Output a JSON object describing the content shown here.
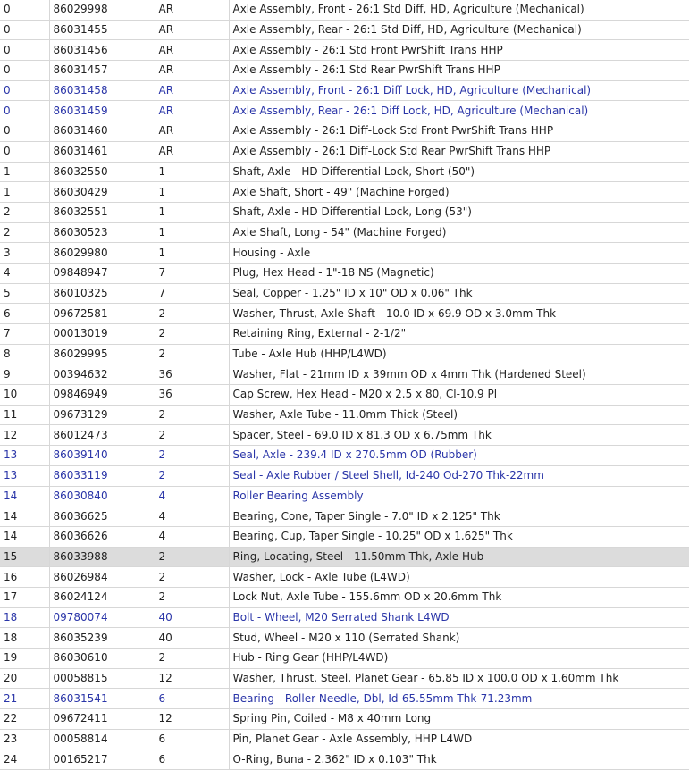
{
  "parts_table": {
    "rows": [
      {
        "ref": "0",
        "part": "86029998",
        "qty": "AR",
        "desc": "Axle Assembly, Front - 26:1 Std Diff, HD, Agriculture (Mechanical)",
        "link": false
      },
      {
        "ref": "0",
        "part": "86031455",
        "qty": "AR",
        "desc": "Axle Assembly, Rear - 26:1 Std Diff, HD, Agriculture (Mechanical)",
        "link": false
      },
      {
        "ref": "0",
        "part": "86031456",
        "qty": "AR",
        "desc": "Axle Assembly - 26:1 Std Front PwrShift Trans HHP",
        "link": false
      },
      {
        "ref": "0",
        "part": "86031457",
        "qty": "AR",
        "desc": "Axle Assembly - 26:1 Std Rear PwrShift Trans HHP",
        "link": false
      },
      {
        "ref": "0",
        "part": "86031458",
        "qty": "AR",
        "desc": "Axle Assembly, Front - 26:1 Diff Lock, HD, Agriculture (Mechanical)",
        "link": true
      },
      {
        "ref": "0",
        "part": "86031459",
        "qty": "AR",
        "desc": "Axle Assembly, Rear - 26:1 Diff Lock, HD, Agriculture (Mechanical)",
        "link": true
      },
      {
        "ref": "0",
        "part": "86031460",
        "qty": "AR",
        "desc": "Axle Assembly - 26:1 Diff-Lock Std Front PwrShift Trans HHP",
        "link": false
      },
      {
        "ref": "0",
        "part": "86031461",
        "qty": "AR",
        "desc": "Axle Assembly - 26:1 Diff-Lock Std Rear PwrShift Trans HHP",
        "link": false
      },
      {
        "ref": "1",
        "part": "86032550",
        "qty": "1",
        "desc": "Shaft, Axle - HD Differential Lock, Short (50\")",
        "link": false
      },
      {
        "ref": "1",
        "part": "86030429",
        "qty": "1",
        "desc": "Axle Shaft, Short - 49\" (Machine Forged)",
        "link": false
      },
      {
        "ref": "2",
        "part": "86032551",
        "qty": "1",
        "desc": "Shaft, Axle - HD Differential Lock, Long (53\")",
        "link": false
      },
      {
        "ref": "2",
        "part": "86030523",
        "qty": "1",
        "desc": "Axle Shaft, Long - 54\" (Machine Forged)",
        "link": false
      },
      {
        "ref": "3",
        "part": "86029980",
        "qty": "1",
        "desc": "Housing - Axle",
        "link": false
      },
      {
        "ref": "4",
        "part": "09848947",
        "qty": "7",
        "desc": "Plug, Hex Head - 1\"-18 NS (Magnetic)",
        "link": false
      },
      {
        "ref": "5",
        "part": "86010325",
        "qty": "7",
        "desc": "Seal, Copper - 1.25\" ID x 10\" OD x 0.06\" Thk",
        "link": false
      },
      {
        "ref": "6",
        "part": "09672581",
        "qty": "2",
        "desc": "Washer, Thrust, Axle Shaft - 10.0 ID x 69.9 OD x 3.0mm Thk",
        "link": false
      },
      {
        "ref": "7",
        "part": "00013019",
        "qty": "2",
        "desc": "Retaining Ring, External - 2-1/2\"",
        "link": false
      },
      {
        "ref": "8",
        "part": "86029995",
        "qty": "2",
        "desc": "Tube - Axle Hub (HHP/L4WD)",
        "link": false
      },
      {
        "ref": "9",
        "part": "00394632",
        "qty": "36",
        "desc": "Washer, Flat - 21mm ID x 39mm OD x 4mm Thk (Hardened Steel)",
        "link": false
      },
      {
        "ref": "10",
        "part": "09846949",
        "qty": "36",
        "desc": "Cap Screw, Hex Head - M20 x 2.5 x 80, Cl-10.9 Pl",
        "link": false
      },
      {
        "ref": "11",
        "part": "09673129",
        "qty": "2",
        "desc": "Washer, Axle Tube - 11.0mm Thick (Steel)",
        "link": false
      },
      {
        "ref": "12",
        "part": "86012473",
        "qty": "2",
        "desc": "Spacer, Steel - 69.0 ID x 81.3 OD x 6.75mm Thk",
        "link": false
      },
      {
        "ref": "13",
        "part": "86039140",
        "qty": "2",
        "desc": "Seal, Axle - 239.4 ID x 270.5mm OD (Rubber)",
        "link": true
      },
      {
        "ref": "13",
        "part": "86033119",
        "qty": "2",
        "desc": "Seal - Axle Rubber / Steel Shell, Id-240 Od-270 Thk-22mm",
        "link": true
      },
      {
        "ref": "14",
        "part": "86030840",
        "qty": "4",
        "desc": "Roller Bearing Assembly",
        "link": true
      },
      {
        "ref": "14",
        "part": "86036625",
        "qty": "4",
        "desc": "Bearing, Cone, Taper Single - 7.0\" ID x 2.125\" Thk",
        "link": false
      },
      {
        "ref": "14",
        "part": "86036626",
        "qty": "4",
        "desc": "Bearing, Cup, Taper Single - 10.25\" OD x 1.625\" Thk",
        "link": false
      },
      {
        "ref": "15",
        "part": "86033988",
        "qty": "2",
        "desc": "Ring, Locating, Steel - 11.50mm Thk, Axle Hub",
        "link": false,
        "highlight": true
      },
      {
        "ref": "16",
        "part": "86026984",
        "qty": "2",
        "desc": "Washer, Lock - Axle Tube (L4WD)",
        "link": false
      },
      {
        "ref": "17",
        "part": "86024124",
        "qty": "2",
        "desc": "Lock Nut, Axle Tube - 155.6mm OD x 20.6mm Thk",
        "link": false
      },
      {
        "ref": "18",
        "part": "09780074",
        "qty": "40",
        "desc": "Bolt - Wheel, M20 Serrated Shank L4WD",
        "link": true
      },
      {
        "ref": "18",
        "part": "86035239",
        "qty": "40",
        "desc": "Stud, Wheel - M20 x 110 (Serrated Shank)",
        "link": false
      },
      {
        "ref": "19",
        "part": "86030610",
        "qty": "2",
        "desc": "Hub - Ring Gear (HHP/L4WD)",
        "link": false
      },
      {
        "ref": "20",
        "part": "00058815",
        "qty": "12",
        "desc": "Washer, Thrust, Steel, Planet Gear - 65.85 ID x 100.0 OD x 1.60mm Thk",
        "link": false
      },
      {
        "ref": "21",
        "part": "86031541",
        "qty": "6",
        "desc": "Bearing - Roller Needle, Dbl, Id-65.55mm Thk-71.23mm",
        "link": true
      },
      {
        "ref": "22",
        "part": "09672411",
        "qty": "12",
        "desc": "Spring Pin, Coiled - M8 x 40mm Long",
        "link": false
      },
      {
        "ref": "23",
        "part": "00058814",
        "qty": "6",
        "desc": "Pin, Planet Gear - Axle Assembly, HHP L4WD",
        "link": false
      },
      {
        "ref": "24",
        "part": "00165217",
        "qty": "6",
        "desc": "O-Ring, Buna - 2.362\" ID x 0.103\" Thk",
        "link": false
      }
    ]
  }
}
